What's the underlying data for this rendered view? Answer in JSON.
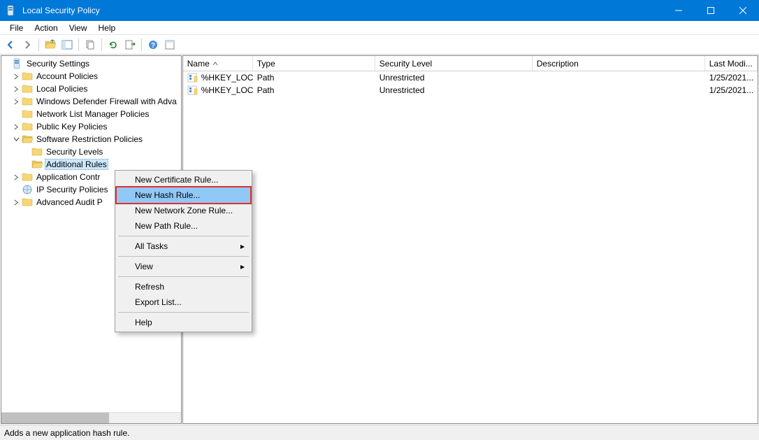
{
  "title": "Local Security Policy",
  "menubar": {
    "file": "File",
    "action": "Action",
    "view": "View",
    "help": "Help"
  },
  "tree": {
    "root": "Security Settings",
    "account": "Account Policies",
    "local": "Local Policies",
    "firewall": "Windows Defender Firewall with Adva",
    "network": "Network List Manager Policies",
    "pubkey": "Public Key Policies",
    "software": "Software Restriction Policies",
    "seclevels": "Security Levels",
    "addrules": "Additional Rules",
    "appcontrol": "Application Contr",
    "ipsec": "IP Security Policies",
    "audit": "Advanced Audit P"
  },
  "columns": {
    "name": "Name",
    "type": "Type",
    "security": "Security Level",
    "description": "Description",
    "modified": "Last Modi..."
  },
  "rows": [
    {
      "name": "%HKEY_LOC...",
      "type": "Path",
      "security": "Unrestricted",
      "description": "",
      "modified": "1/25/2021..."
    },
    {
      "name": "%HKEY_LOC...",
      "type": "Path",
      "security": "Unrestricted",
      "description": "",
      "modified": "1/25/2021..."
    }
  ],
  "contextmenu": {
    "new_cert": "New Certificate Rule...",
    "new_hash": "New Hash Rule...",
    "new_zone": "New Network Zone Rule...",
    "new_path": "New Path Rule...",
    "all_tasks": "All Tasks",
    "view": "View",
    "refresh": "Refresh",
    "export": "Export List...",
    "help": "Help"
  },
  "status": "Adds a new application hash rule."
}
